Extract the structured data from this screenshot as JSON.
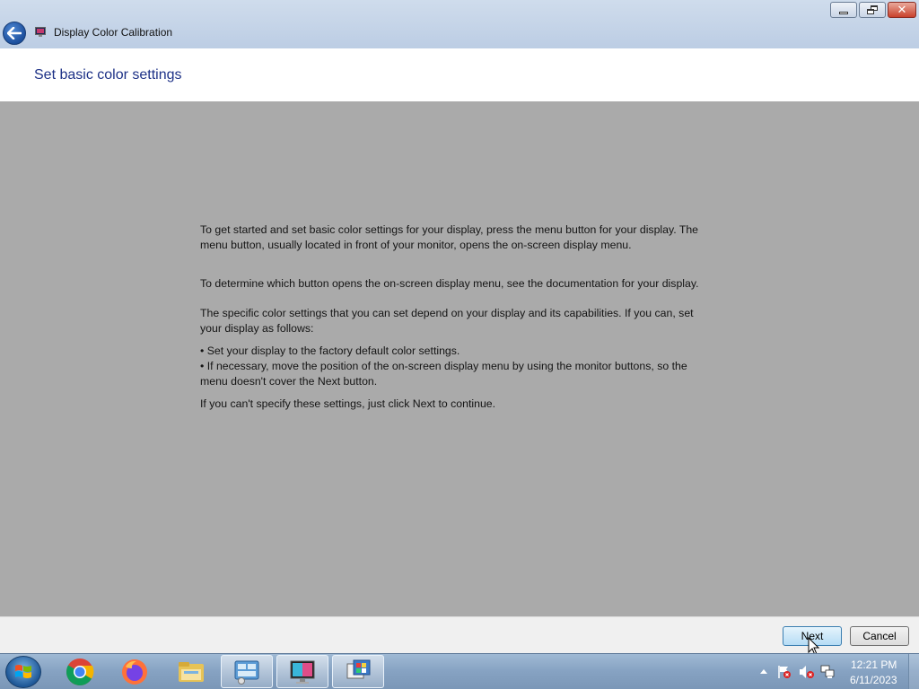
{
  "window": {
    "title": "Display Color Calibration",
    "controls": {
      "minimize": "minimize",
      "restore": "restore",
      "close": "close"
    }
  },
  "header": {
    "title": "Set basic color settings"
  },
  "content": {
    "paragraph1": "To get started and set basic color settings for your display, press the menu button for your display. The menu button, usually located in front of your monitor, opens the on-screen display menu.",
    "paragraph2": "To determine which button opens the on-screen display menu, see the documentation for your display.",
    "paragraph3": "The specific color settings that you can set depend on your display and its capabilities. If you can, set your display as follows:",
    "bullet1": "• Set your display to the factory default color settings.",
    "bullet2": "• If necessary, move the position of the on-screen display menu by using the monitor buttons, so the menu doesn't cover the Next button.",
    "paragraph4": "If you can't specify these settings,  just click Next to continue."
  },
  "footer": {
    "next_label": "Next",
    "cancel_label": "Cancel"
  },
  "taskbar": {
    "items": [
      "start-orb",
      "chrome",
      "firefox",
      "file-explorer",
      "control-panel",
      "display-calibration",
      "color-management"
    ],
    "clock_time": "12:21 PM",
    "clock_date": "6/11/2023"
  },
  "colors": {
    "title_text": "#1e3287",
    "content_bg": "#aaaaaa",
    "titlebar_bg": "#c5d5ea"
  }
}
